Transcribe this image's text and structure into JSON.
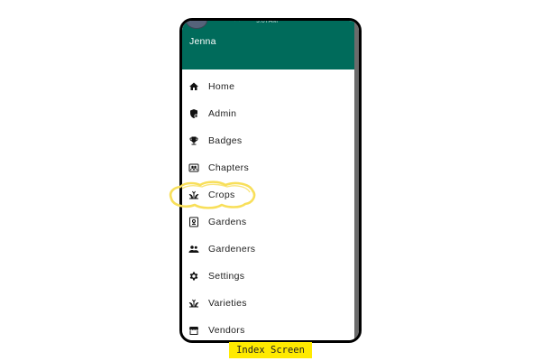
{
  "header": {
    "username": "Jenna",
    "status_time": "9:07AM",
    "color": "#006b5b"
  },
  "menu": {
    "items": [
      {
        "label": "Home",
        "icon": "home-icon"
      },
      {
        "label": "Admin",
        "icon": "admin-shield-icon"
      },
      {
        "label": "Badges",
        "icon": "trophy-icon"
      },
      {
        "label": "Chapters",
        "icon": "chapters-group-icon"
      },
      {
        "label": "Crops",
        "icon": "sprout-icon"
      },
      {
        "label": "Gardens",
        "icon": "garden-frame-icon"
      },
      {
        "label": "Gardeners",
        "icon": "people-icon"
      },
      {
        "label": "Settings",
        "icon": "gear-icon"
      },
      {
        "label": "Varieties",
        "icon": "sprout-icon"
      },
      {
        "label": "Vendors",
        "icon": "storefront-icon"
      }
    ],
    "highlighted": "Crops",
    "highlight_color": "#f8df5a"
  },
  "caption": {
    "text": "Index Screen",
    "background": "#ffea00"
  }
}
